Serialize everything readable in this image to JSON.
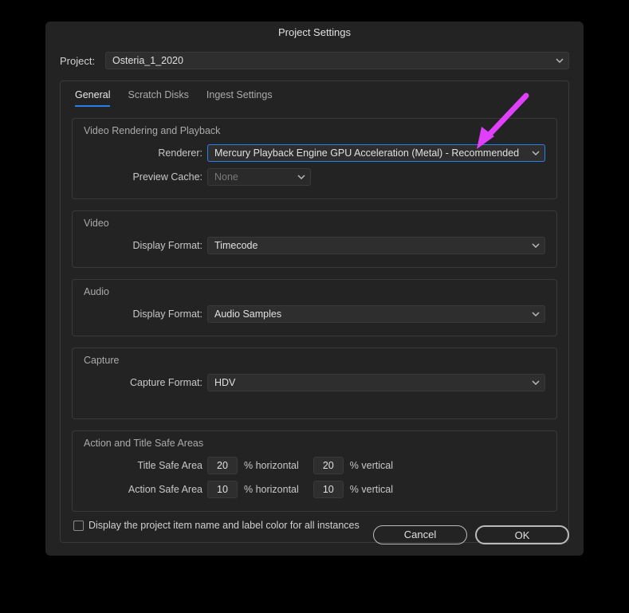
{
  "window": {
    "title": "Project Settings"
  },
  "project": {
    "label": "Project:",
    "value": "Osteria_1_2020"
  },
  "tabs": {
    "general": "General",
    "scratch": "Scratch Disks",
    "ingest": "Ingest Settings"
  },
  "groups": {
    "render": {
      "title": "Video Rendering and Playback",
      "renderer_label": "Renderer:",
      "renderer_value": "Mercury Playback Engine GPU Acceleration (Metal) - Recommended",
      "cache_label": "Preview Cache:",
      "cache_value": "None"
    },
    "video": {
      "title": "Video",
      "format_label": "Display Format:",
      "format_value": "Timecode"
    },
    "audio": {
      "title": "Audio",
      "format_label": "Display Format:",
      "format_value": "Audio Samples"
    },
    "capture": {
      "title": "Capture",
      "format_label": "Capture Format:",
      "format_value": "HDV"
    },
    "safe": {
      "title": "Action and Title Safe Areas",
      "title_safe_label": "Title Safe Area",
      "action_safe_label": "Action Safe Area",
      "horiz": "% horizontal",
      "vert": "% vertical",
      "title_h": "20",
      "title_v": "20",
      "action_h": "10",
      "action_v": "10"
    }
  },
  "checkbox": {
    "label": "Display the project item name and label color for all instances"
  },
  "buttons": {
    "cancel": "Cancel",
    "ok": "OK"
  },
  "colors": {
    "accent": "#2680eb",
    "arrow": "#e040fb"
  }
}
